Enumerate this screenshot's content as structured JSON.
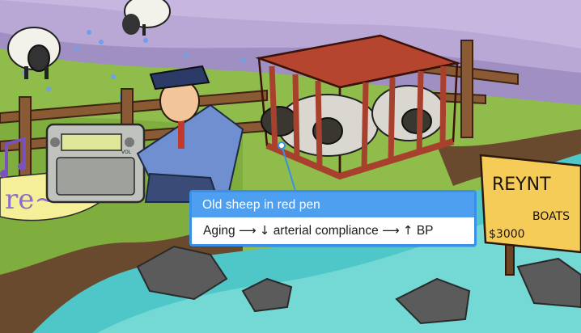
{
  "illustration": {
    "music_text": "re~",
    "sign_line1": "REYNT",
    "sign_line2": "BOATS",
    "sign_price": "$3000",
    "radio_brand": "VOL"
  },
  "callout": {
    "title": "Old sheep in red pen",
    "body_parts": [
      "Aging",
      "⟶",
      "↓",
      "arterial compliance",
      "⟶",
      "↑",
      "BP"
    ]
  },
  "colors": {
    "callout_border": "#3b8fe6",
    "callout_header": "#4f9ff0",
    "water": "#4fc7c9",
    "grass": "#8fbc4a",
    "sky": "#b8a9d9",
    "pen": "#a8402e"
  }
}
